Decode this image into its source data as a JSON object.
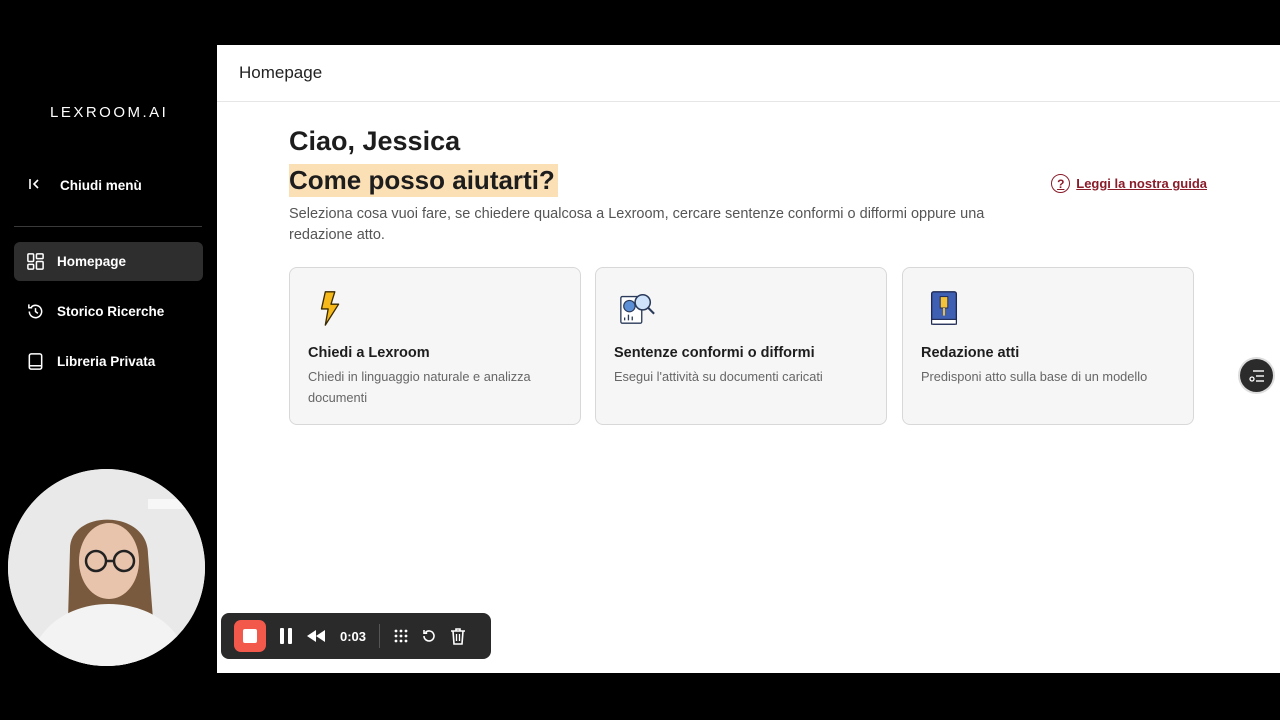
{
  "sidebar": {
    "logo": "LEXROOM.AI",
    "close_menu": "Chiudi menù",
    "items": [
      {
        "label": "Homepage",
        "icon": "dashboard-icon",
        "active": true
      },
      {
        "label": "Storico Ricerche",
        "icon": "history-icon",
        "active": false
      },
      {
        "label": "Libreria Privata",
        "icon": "book-icon",
        "active": false
      }
    ]
  },
  "header": {
    "title": "Homepage"
  },
  "main": {
    "greeting": "Ciao, Jessica",
    "question": "Come posso aiutarti?",
    "guide_link": "Leggi la nostra guida",
    "subtitle": "Seleziona cosa vuoi fare, se chiedere qualcosa a Lexroom, cercare sentenze conformi o difformi oppure una redazione atto.",
    "cards": [
      {
        "title": "Chiedi a Lexroom",
        "description": "Chiedi in linguaggio naturale e analizza documenti",
        "icon": "lightning-icon"
      },
      {
        "title": "Sentenze conformi o difformi",
        "description": "Esegui l'attività su documenti caricati",
        "icon": "document-search-icon"
      },
      {
        "title": "Redazione atti",
        "description": "Predisponi atto sulla base di un modello",
        "icon": "book-icon"
      }
    ]
  },
  "recorder": {
    "time": "0:03"
  },
  "colors": {
    "accent": "#8a1c2a",
    "highlight": "#fbe0b6",
    "record": "#f2594b"
  }
}
